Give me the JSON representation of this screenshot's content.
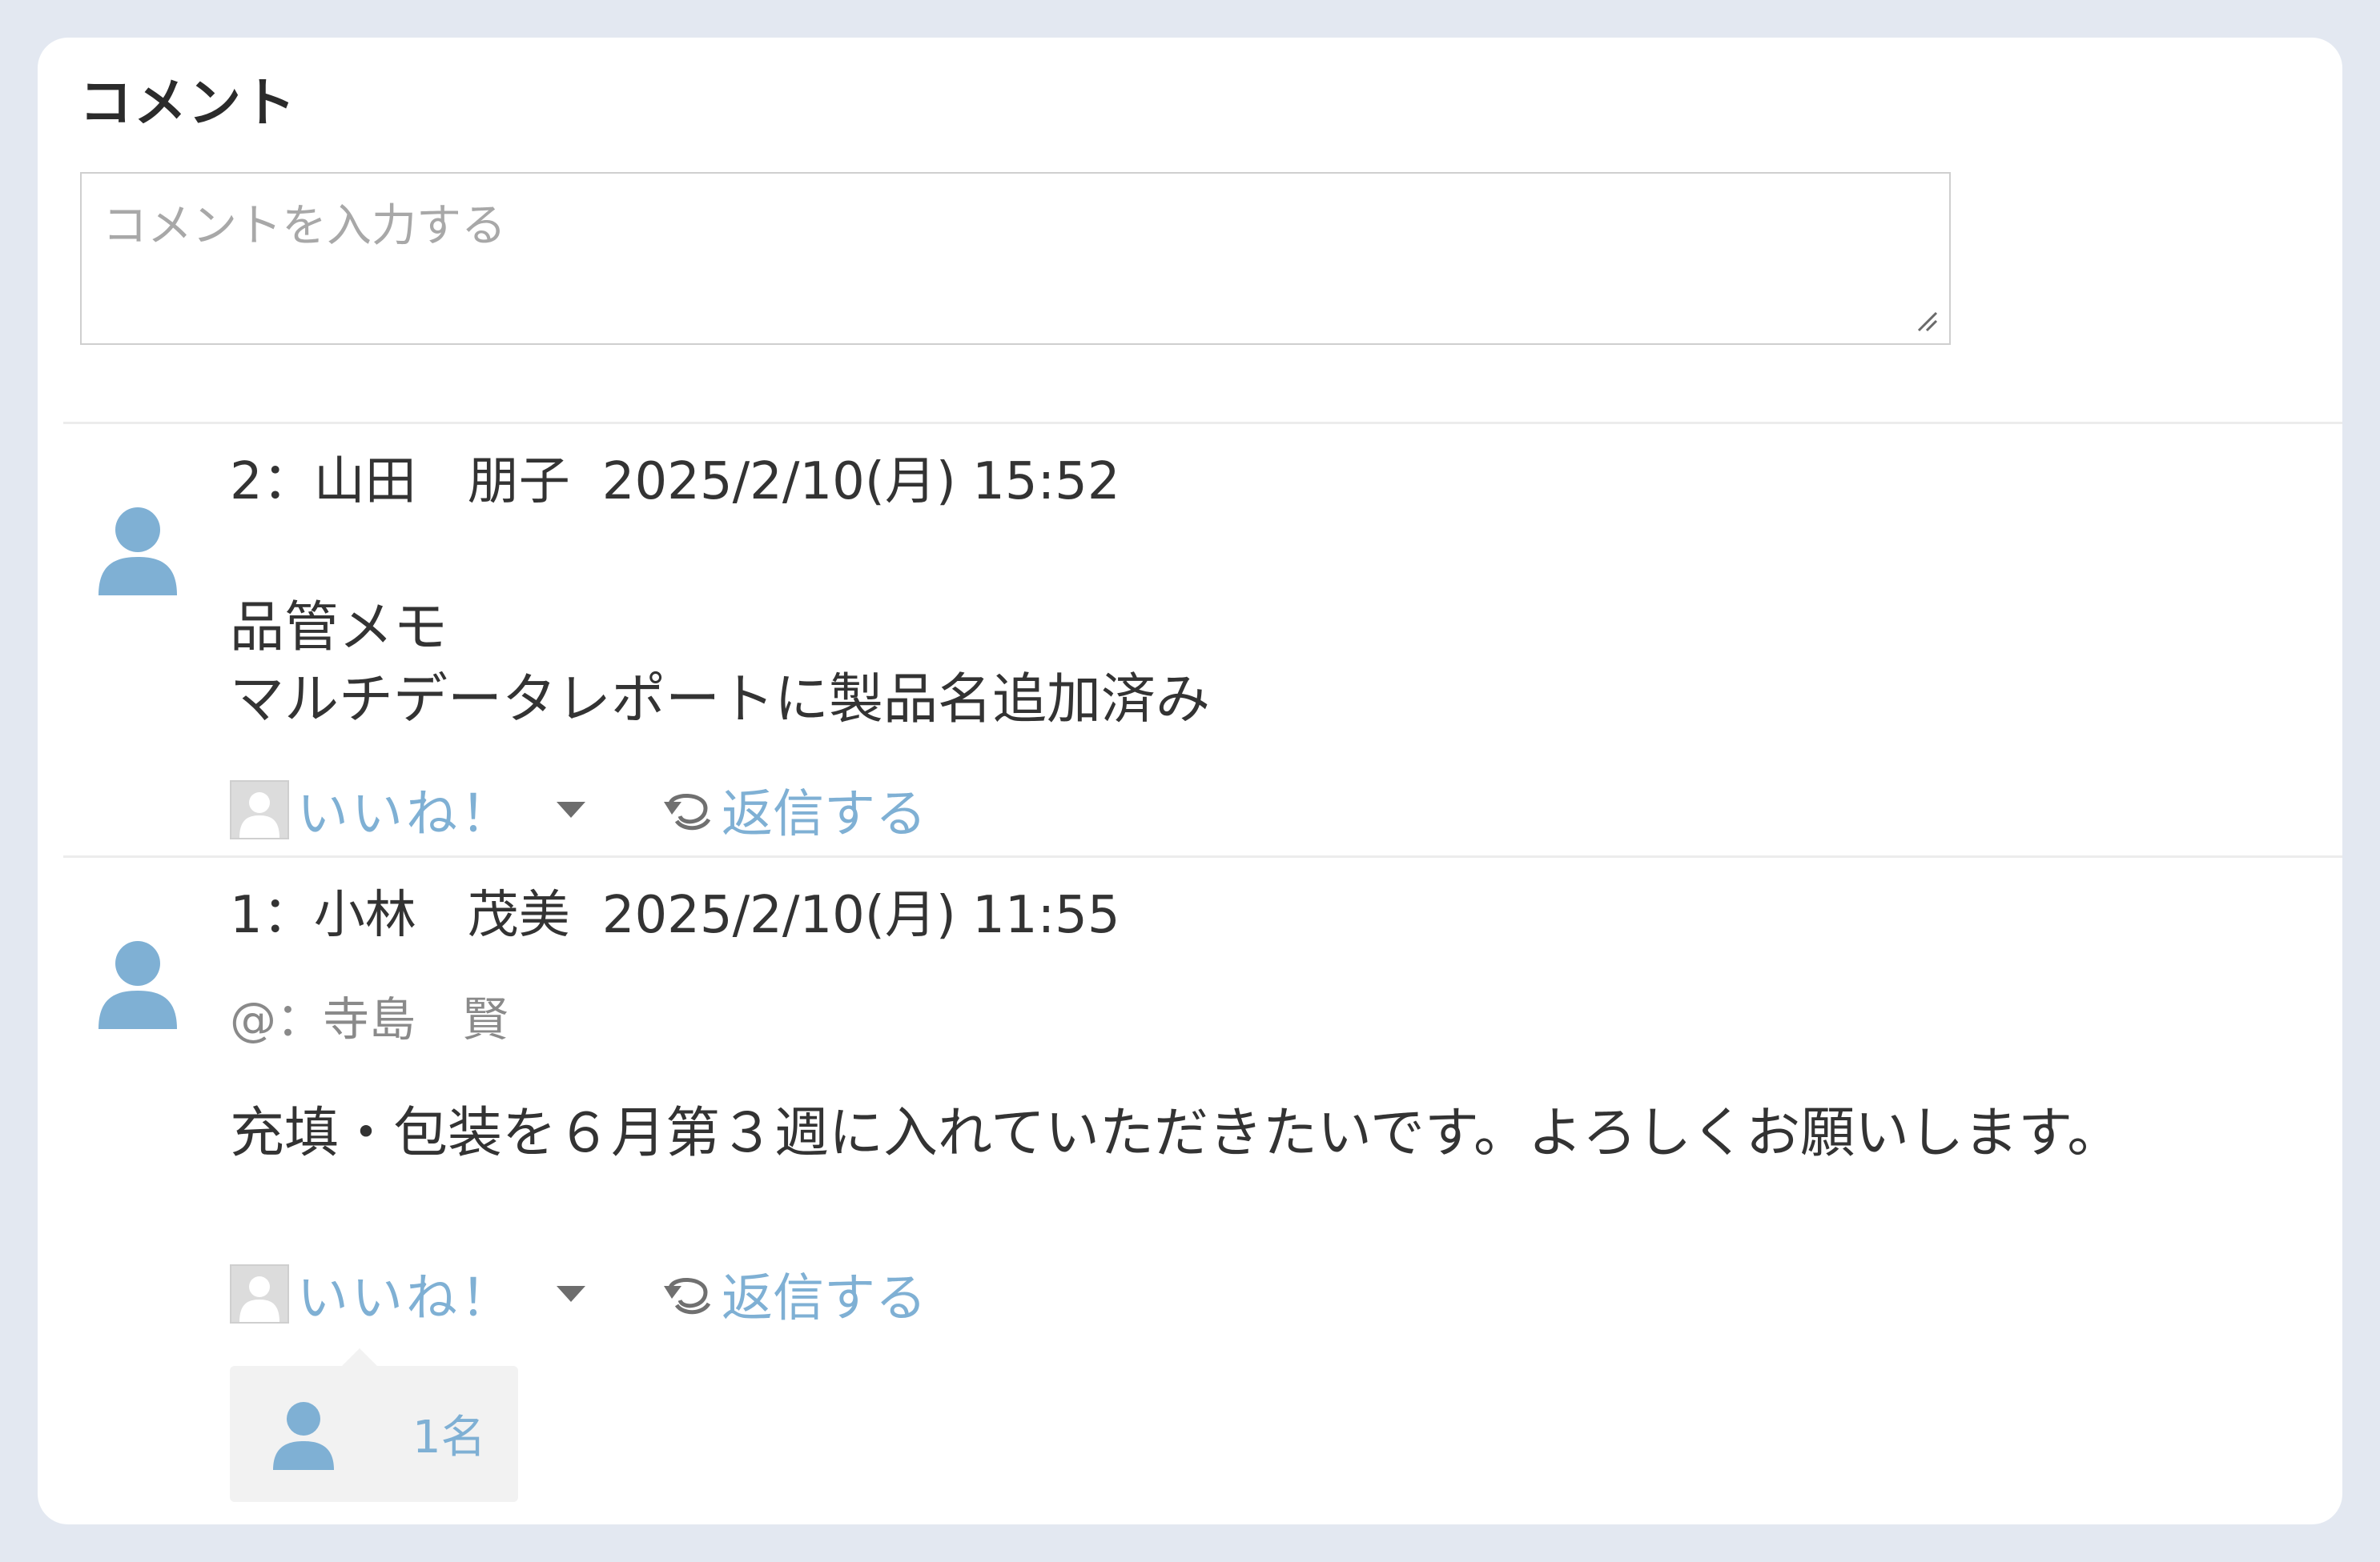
{
  "section": {
    "title": "コメント"
  },
  "input": {
    "placeholder": "コメントを入力する",
    "value": ""
  },
  "comments": [
    {
      "number": "2",
      "separator": "：",
      "author": "山田　朋子",
      "date": "2025/2/10(月) 15:52",
      "mention": "",
      "body": "品管メモ\nマルチデータレポートに製品名追加済み",
      "like_label": "いいね！",
      "reply_label": "返信する",
      "likers": null
    },
    {
      "number": "1",
      "separator": "：",
      "author": "小林　茂美",
      "date": "2025/2/10(月) 11:55",
      "mention": "@：寺島　賢",
      "body": "充填・包装を６月第３週に入れていただきたいです。よろしくお願いします。",
      "like_label": "いいね！",
      "reply_label": "返信する",
      "likers": {
        "count_label": "1名"
      }
    }
  ],
  "colors": {
    "link": "#7fb0d4",
    "avatar": "#7fb0d4",
    "text": "#333333",
    "muted": "#8a8a8a",
    "background": "#e3e8f1"
  },
  "icons": {
    "avatar": "user-avatar-icon",
    "like": "like-checkbox-icon",
    "dropdown": "caret-down-icon",
    "reply": "reply-arrow-icon",
    "resize": "resize-grip-icon"
  }
}
